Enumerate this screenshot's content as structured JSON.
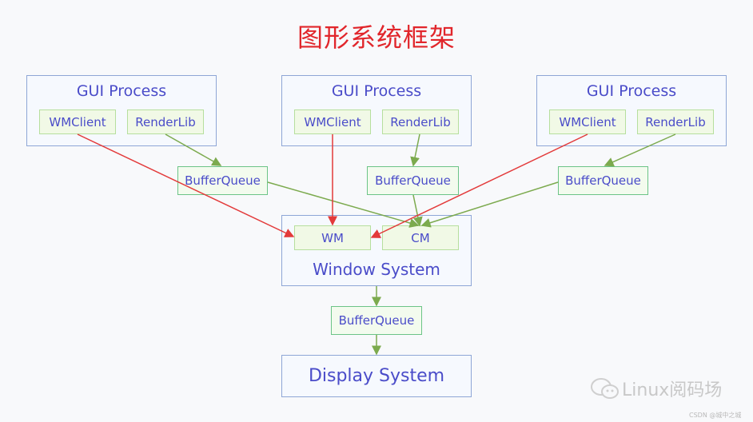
{
  "title": "图形系统框架",
  "colors": {
    "title": "#e1262b",
    "text": "#4a4cc9",
    "red_arrow": "#e33a3a",
    "green_arrow": "#7caa4e"
  },
  "processes": [
    {
      "label": "GUI Process",
      "wmclient": "WMClient",
      "renderlib": "RenderLib",
      "bufferqueue": "BufferQueue"
    },
    {
      "label": "GUI Process",
      "wmclient": "WMClient",
      "renderlib": "RenderLib",
      "bufferqueue": "BufferQueue"
    },
    {
      "label": "GUI Process",
      "wmclient": "WMClient",
      "renderlib": "RenderLib",
      "bufferqueue": "BufferQueue"
    }
  ],
  "window_system": {
    "label": "Window System",
    "wm": "WM",
    "cm": "CM"
  },
  "output_bufferqueue": "BufferQueue",
  "display_system": "Display System",
  "watermark": {
    "main": "Linux阅码场",
    "sub": "CSDN @城中之城"
  }
}
